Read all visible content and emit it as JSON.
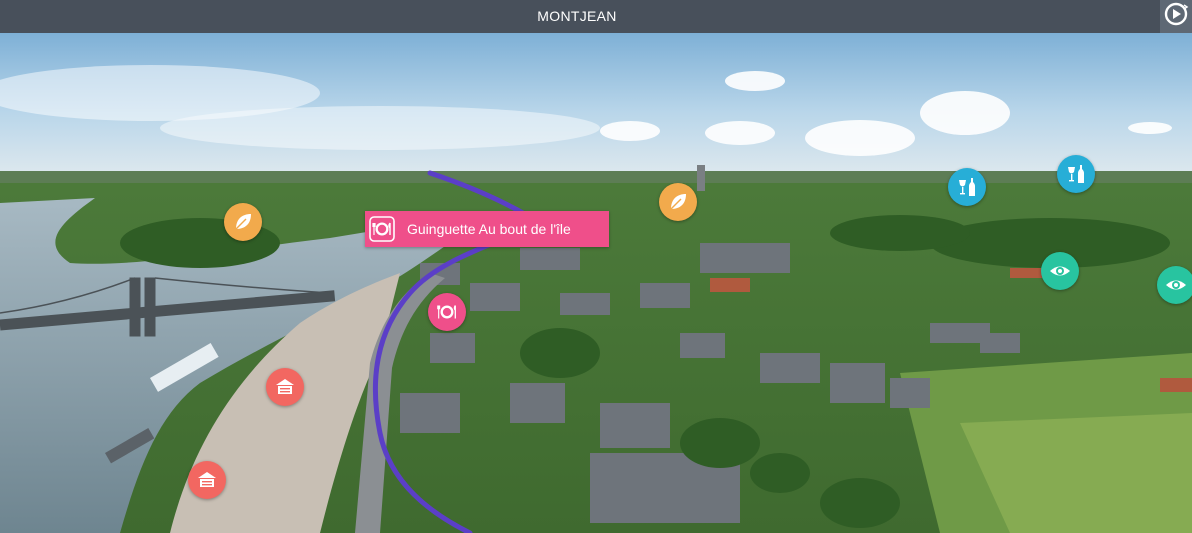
{
  "header": {
    "title": "MONTJEAN",
    "play_icon": "play-circle-icon"
  },
  "tooltip": {
    "label": "Guinguette Au bout de l'île",
    "icon": "restaurant-icon"
  },
  "markers": [
    {
      "name": "poi-leaf-west",
      "category": "nature",
      "icon": "leaf-icon"
    },
    {
      "name": "poi-leaf-east",
      "category": "nature",
      "icon": "leaf-icon"
    },
    {
      "name": "poi-restaurant",
      "category": "restaurant",
      "icon": "restaurant-icon"
    },
    {
      "name": "poi-wine-1",
      "category": "wine",
      "icon": "wine-icon"
    },
    {
      "name": "poi-wine-2",
      "category": "wine",
      "icon": "wine-icon"
    },
    {
      "name": "poi-view-1",
      "category": "viewpoint",
      "icon": "eye-icon"
    },
    {
      "name": "poi-view-2",
      "category": "viewpoint",
      "icon": "eye-icon"
    },
    {
      "name": "poi-lodging-1",
      "category": "lodging",
      "icon": "lodging-icon"
    },
    {
      "name": "poi-lodging-2",
      "category": "lodging",
      "icon": "lodging-icon"
    }
  ],
  "colors": {
    "header_bg": "#48505b",
    "restaurant": "#ef4f8a",
    "nature": "#f2aa4c",
    "wine": "#27aed7",
    "viewpoint": "#28c4a0",
    "lodging": "#f26761",
    "route": "#5b3fc7"
  }
}
